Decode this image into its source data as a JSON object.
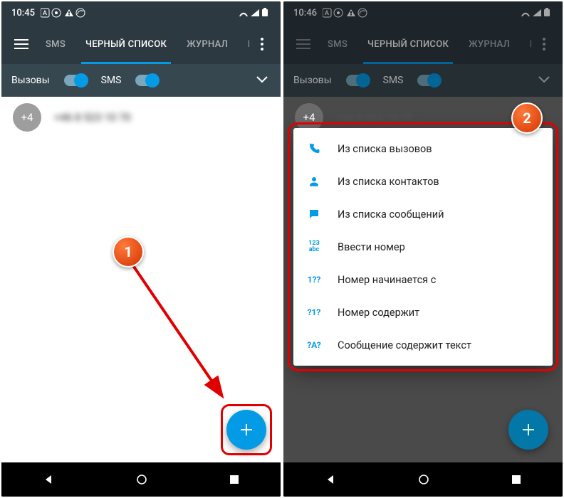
{
  "left": {
    "clock": "10:45",
    "tabs": {
      "sms": "SMS",
      "blacklist": "ЧЕРНЫЙ СПИСОК",
      "journal": "ЖУРНАЛ",
      "p": "Р"
    },
    "filter": {
      "calls": "Вызовы",
      "sms": "SMS"
    },
    "list": {
      "avatar": "+4",
      "label_blurred": "+46 8 523 10 70"
    },
    "callout": "1"
  },
  "right": {
    "clock": "10:46",
    "tabs": {
      "sms": "SMS",
      "blacklist": "ЧЕРНЫЙ СПИСОК",
      "journal": "ЖУРНАЛ",
      "p": "Р"
    },
    "filter": {
      "calls": "Вызовы",
      "sms": "SMS"
    },
    "list": {
      "avatar": "+4",
      "label_blurred": "+46 8 523 10 70"
    },
    "menu": {
      "from_calls": "Из списка вызовов",
      "from_contacts": "Из списка контактов",
      "from_messages": "Из списка сообщений",
      "enter_number": "Ввести номер",
      "starts_with": "Номер начинается с",
      "contains": "Номер содержит",
      "msg_contains": "Сообщение содержит текст",
      "icon_enter": "123\nabc",
      "icon_starts": "1??",
      "icon_contains": "?1?",
      "icon_msg": "?A?"
    },
    "callout": "2"
  }
}
